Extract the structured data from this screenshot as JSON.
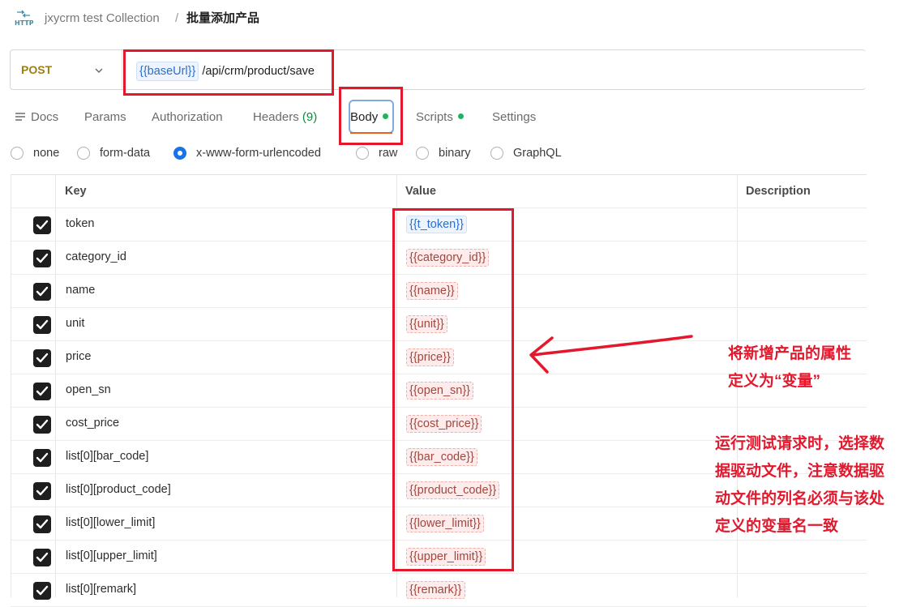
{
  "breadcrumb": {
    "collection": "jxycrm test Collection",
    "separator": "/",
    "request_name": "批量添加产品",
    "http_icon_text": "HTTP"
  },
  "request": {
    "method": "POST",
    "url_variable": "{{baseUrl}}",
    "url_path": " /api/crm/product/save"
  },
  "tabs": [
    {
      "label": "Docs"
    },
    {
      "label": "Params"
    },
    {
      "label": "Authorization"
    },
    {
      "label": "Headers",
      "count": "(9)"
    },
    {
      "label": "Body",
      "active": true
    },
    {
      "label": "Scripts"
    },
    {
      "label": "Settings"
    }
  ],
  "body_modes": [
    {
      "label": "none",
      "selected": false
    },
    {
      "label": "form-data",
      "selected": false
    },
    {
      "label": "x-www-form-urlencoded",
      "selected": true
    },
    {
      "label": "raw",
      "selected": false
    },
    {
      "label": "binary",
      "selected": false
    },
    {
      "label": "GraphQL",
      "selected": false
    }
  ],
  "table": {
    "headers": {
      "key": "Key",
      "value": "Value",
      "description": "Description"
    },
    "rows": [
      {
        "key": "token",
        "value": "{{t_token}}",
        "var_state": "defined"
      },
      {
        "key": "category_id",
        "value": "{{category_id}}",
        "var_state": "undefined"
      },
      {
        "key": "name",
        "value": "{{name}}",
        "var_state": "undefined"
      },
      {
        "key": "unit",
        "value": "{{unit}}",
        "var_state": "undefined"
      },
      {
        "key": "price",
        "value": "{{price}}",
        "var_state": "undefined"
      },
      {
        "key": "open_sn",
        "value": "{{open_sn}}",
        "var_state": "undefined"
      },
      {
        "key": "cost_price",
        "value": "{{cost_price}}",
        "var_state": "undefined"
      },
      {
        "key": "list[0][bar_code]",
        "value": "{{bar_code}}",
        "var_state": "undefined"
      },
      {
        "key": "list[0][product_code]",
        "value": "{{product_code}}",
        "var_state": "undefined"
      },
      {
        "key": "list[0][lower_limit]",
        "value": "{{lower_limit}}",
        "var_state": "undefined"
      },
      {
        "key": "list[0][upper_limit]",
        "value": "{{upper_limit}}",
        "var_state": "undefined"
      },
      {
        "key": "list[0][remark]",
        "value": "{{remark}}",
        "var_state": "undefined"
      }
    ]
  },
  "annotations": {
    "note1": [
      "将新增产品的属性",
      "定义为“变量”"
    ],
    "note2": [
      "运行测试请求时，选择数",
      "据驱动文件，注意数据驱",
      "动文件的列名必须与该处",
      "定义的变量名一致"
    ],
    "color": "#e3182d"
  },
  "colors": {
    "method": "#9e7d13",
    "active_radio": "#1a73e8",
    "tab_dot": "#1fb35a",
    "defined_var": "#2a6fd0",
    "undefined_var": "#a1463e"
  }
}
